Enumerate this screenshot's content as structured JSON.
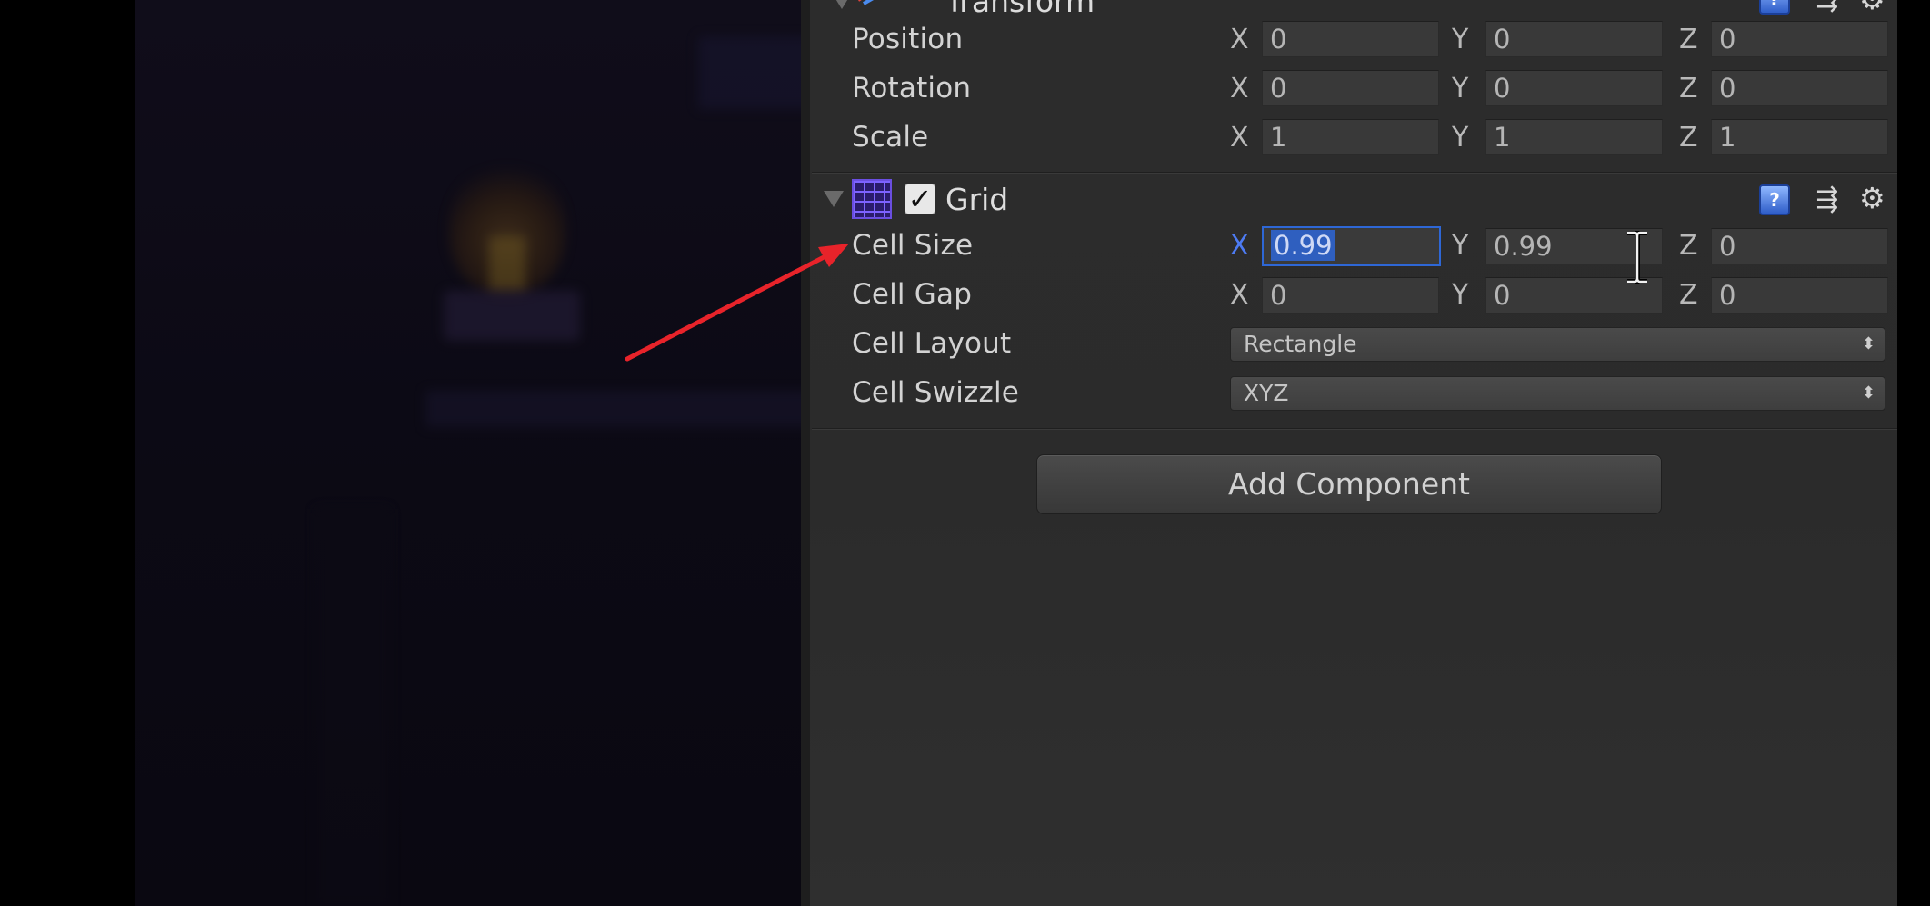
{
  "transform": {
    "title": "Transform",
    "rows": [
      {
        "label": "Position",
        "x": "0",
        "y": "0",
        "z": "0"
      },
      {
        "label": "Rotation",
        "x": "0",
        "y": "0",
        "z": "0"
      },
      {
        "label": "Scale",
        "x": "1",
        "y": "1",
        "z": "1"
      }
    ]
  },
  "grid": {
    "title": "Grid",
    "enabled": true,
    "cell_size": {
      "label": "Cell Size",
      "x": "0.99",
      "y": "0.99",
      "z": "0"
    },
    "cell_gap": {
      "label": "Cell Gap",
      "x": "0",
      "y": "0",
      "z": "0"
    },
    "cell_layout": {
      "label": "Cell Layout",
      "value": "Rectangle"
    },
    "cell_swizzle": {
      "label": "Cell Swizzle",
      "value": "XYZ"
    }
  },
  "axes": {
    "x": "X",
    "y": "Y",
    "z": "Z"
  },
  "add_component_label": "Add Component",
  "icons": {
    "grid": "grid-icon",
    "help": "help-icon",
    "presets": "presets-icon",
    "settings": "gear-icon",
    "fold": "foldout-triangle-icon",
    "checkbox": "checkmark-icon"
  },
  "colors": {
    "inspector_bg": "#2b2b2b",
    "field_bg": "#393939",
    "focus_blue": "#2e67d6",
    "annotation_red": "#e8232a",
    "grid_icon_purple": "#6a4ee0"
  }
}
